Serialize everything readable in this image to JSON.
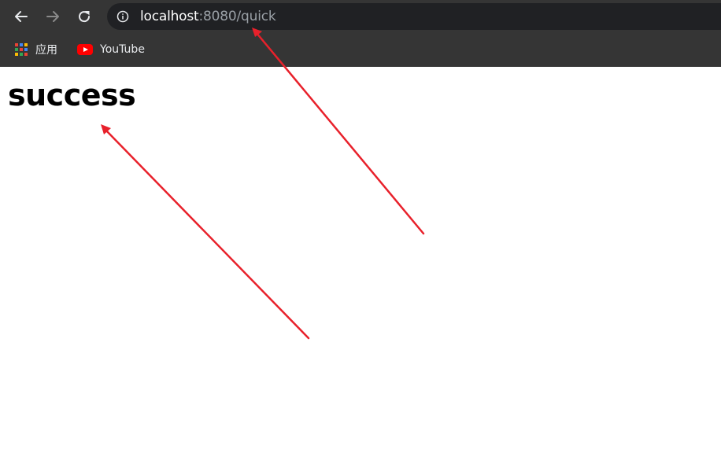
{
  "browser": {
    "url_host": "localhost",
    "url_rest": ":8080/quick",
    "back_icon": "arrow-left-icon",
    "forward_icon": "arrow-right-icon",
    "reload_icon": "reload-icon",
    "info_icon": "info-icon"
  },
  "bookmarks": {
    "items": [
      {
        "label": "应用",
        "icon": "apps-grid-icon"
      },
      {
        "label": "YouTube",
        "icon": "youtube-icon"
      }
    ]
  },
  "page": {
    "heading": "success"
  },
  "colors": {
    "toolbar_bg": "#353535",
    "address_bg": "#202124",
    "annotation_arrow": "#e8212b",
    "youtube_red": "#ff0000"
  }
}
